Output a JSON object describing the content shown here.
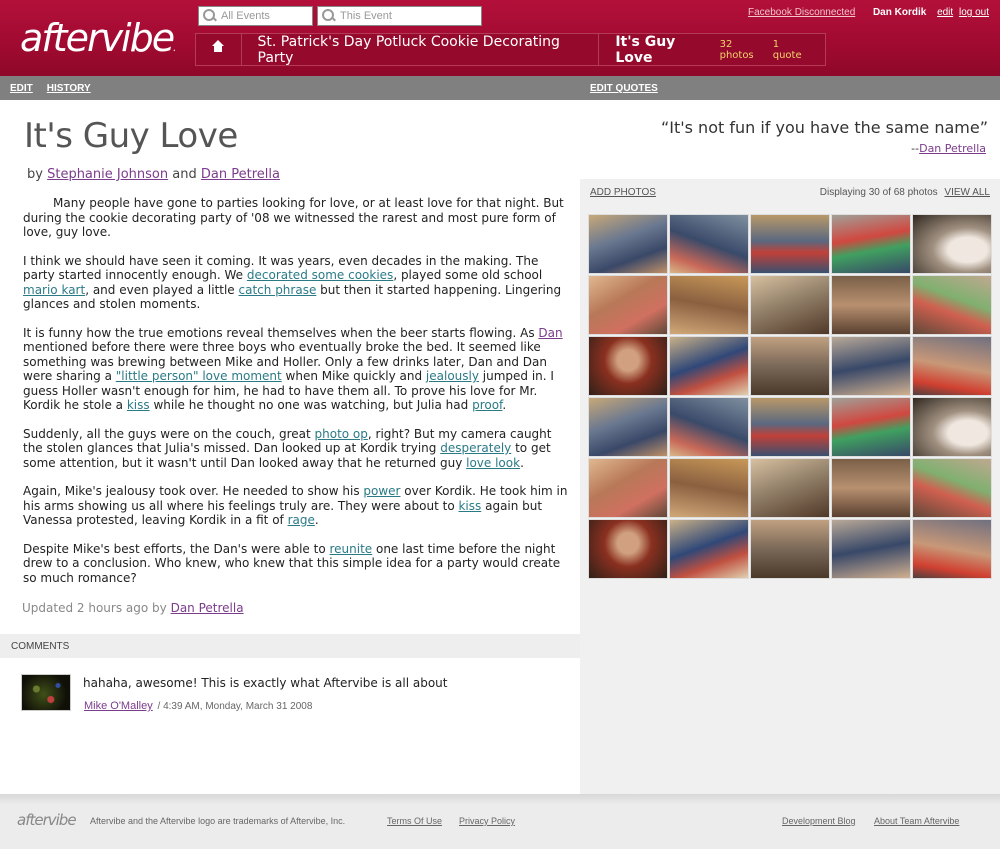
{
  "header": {
    "logo": "aftervibe",
    "search_all_placeholder": "All Events",
    "search_event_placeholder": "This Event",
    "facebook_status": "Facebook Disconnected",
    "user_name": "Dan Kordik",
    "edit_link": "edit",
    "logout_link": "log out",
    "crumbs": {
      "party": "St. Patrick's Day Potluck Cookie Decorating Party",
      "current": "It's Guy Love",
      "photos_count": "32 photos",
      "quote_count": "1 quote"
    }
  },
  "left": {
    "tabs": {
      "edit": "EDIT",
      "history": "HISTORY"
    },
    "title": "It's Guy Love",
    "byline": {
      "by": "by",
      "author1": "Stephanie Johnson",
      "and": "and",
      "author2": "Dan Petrella"
    },
    "updated": {
      "prefix": "Updated 2 hours ago by",
      "author": "Dan Petrella"
    },
    "comments_header": "COMMENTS",
    "comment": {
      "text": "hahaha, awesome! This is exactly what Aftervibe is all about",
      "author": "Mike O'Malley",
      "timestamp": "/ 4:39 AM, Monday, March 31 2008"
    }
  },
  "story": {
    "p1": "Many people have gone to parties looking for love, or at least love for that night.  But during the cookie decorating party of '08 we witnessed the rarest and most pure form of love, guy love.",
    "p2_a": "I think we should have seen it coming.  It was years, even decades in the making.  The party started innocently enough. We ",
    "p2_l1": "decorated some cookies",
    "p2_b": ", played some old school ",
    "p2_l2": "mario kart",
    "p2_c": ", and even played a little ",
    "p2_l3": "catch phrase",
    "p2_d": " but then it started happening.   Lingering glances and stolen moments.",
    "p3_a": "It is funny how the true emotions reveal themselves when the beer starts flowing.  As ",
    "p3_l1": "Dan",
    "p3_b": " mentioned before there were three boys who eventually broke the bed.  It seemed like something was brewing between Mike and Holler.  Only a few drinks later,  Dan and Dan were sharing a ",
    "p3_l2": "\"little person\" love moment",
    "p3_c": " when Mike quickly and ",
    "p3_l3": "jealously",
    "p3_d": " jumped in.  I guess Holler wasn't enough for him, he had to have them all.   To prove his love for Mr. Kordik he stole a ",
    "p3_l4": "kiss",
    "p3_e": " while he thought no one was watching, but Julia had ",
    "p3_l5": "proof",
    "p3_f": ".",
    "p4_a": "Suddenly, all the guys were on the couch, great ",
    "p4_l1": "photo op",
    "p4_b": ", right?  But my camera caught the stolen glances that Julia's missed.  Dan looked up at Kordik trying ",
    "p4_l2": "desperately",
    "p4_c": " to get some attention,  but it wasn't until Dan looked away that he returned guy ",
    "p4_l3": "love look",
    "p4_d": ".",
    "p5_a": "Again, Mike's jealousy took over.  He needed to show his ",
    "p5_l1": "power",
    "p5_b": " over Kordik.  He took him in his arms showing us all where his feelings  truly are.  They were about to ",
    "p5_l2": "kiss",
    "p5_c": "  again but Vanessa protested, leaving Kordik in a fit of ",
    "p5_l3": "rage",
    "p5_d": ".",
    "p6_a": "Despite Mike's best efforts, the Dan's were able to ",
    "p6_l1": "reunite",
    "p6_b": " one last time before the night drew to a conclusion.  Who knew, who knew that this simple idea for a party would create so much romance?"
  },
  "right": {
    "edit_quotes": "EDIT QUOTES",
    "quote": "“It's not fun if you have the same name”",
    "quote_dash": "--",
    "quote_author": "Dan Petrella",
    "add_photos": "ADD PHOTOS",
    "displaying": "Displaying 30 of 68 photos",
    "view_all": "VIEW ALL",
    "photos": [
      "t1",
      "t2",
      "t3",
      "t4",
      "t5",
      "t6",
      "t7",
      "t8",
      "t9",
      "t10",
      "t11",
      "t12",
      "t13",
      "t14",
      "t15",
      "t1",
      "t2",
      "t3",
      "t4",
      "t5",
      "t6",
      "t7",
      "t8",
      "t9",
      "t10",
      "t11",
      "t12",
      "t13",
      "t14",
      "t15"
    ]
  },
  "footer": {
    "logo": "aftervibe",
    "trademark": "Aftervibe and the Aftervibe logo are trademarks of Aftervibe, Inc.",
    "terms": "Terms Of Use",
    "privacy": "Privacy Policy",
    "dev_blog": "Development Blog",
    "about": "About Team Aftervibe"
  }
}
